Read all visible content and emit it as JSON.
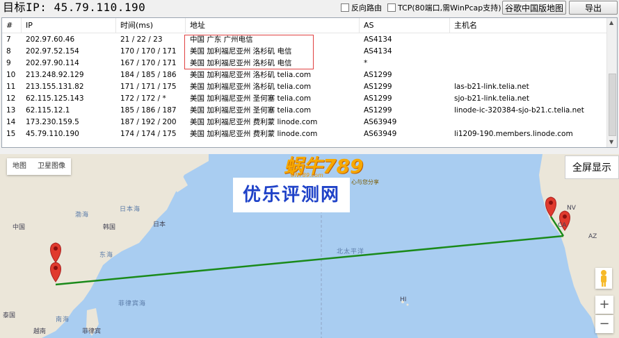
{
  "topbar": {
    "target_ip": "目标IP: 45.79.110.190",
    "reverse_label": "反向路由",
    "tcp_label": "TCP(80端口,需WinPcap支持)",
    "google_map_button": "谷歌中国版地图",
    "export_button": "导出"
  },
  "table": {
    "headers": [
      "#",
      "IP",
      "时间(ms)",
      "地址",
      "AS",
      "主机名"
    ],
    "rows": [
      {
        "n": "7",
        "ip": "202.97.60.46",
        "time": "21 / 22 / 23",
        "addr": "中国 广东 广州电信",
        "as": "AS4134",
        "host": ""
      },
      {
        "n": "8",
        "ip": "202.97.52.154",
        "time": "170 / 170 / 171",
        "addr": "美国 加利福尼亚州 洛杉矶 电信",
        "as": "AS4134",
        "host": ""
      },
      {
        "n": "9",
        "ip": "202.97.90.114",
        "time": "167 / 170 / 171",
        "addr": "美国 加利福尼亚州 洛杉矶 电信",
        "as": "*",
        "host": ""
      },
      {
        "n": "10",
        "ip": "213.248.92.129",
        "time": "184 / 185 / 186",
        "addr": "美国 加利福尼亚州 洛杉矶 telia.com",
        "as": "AS1299",
        "host": ""
      },
      {
        "n": "11",
        "ip": "213.155.131.82",
        "time": "171 / 171 / 175",
        "addr": "美国 加利福尼亚州 洛杉矶 telia.com",
        "as": "AS1299",
        "host": "las-b21-link.telia.net"
      },
      {
        "n": "12",
        "ip": "62.115.125.143",
        "time": "172 / 172 / *",
        "addr": "美国 加利福尼亚州 圣何塞 telia.com",
        "as": "AS1299",
        "host": "sjo-b21-link.telia.net"
      },
      {
        "n": "13",
        "ip": "62.115.12.1",
        "time": "185 / 186 / 187",
        "addr": "美国 加利福尼亚州 圣何塞 telia.com",
        "as": "AS1299",
        "host": "linode-ic-320384-sjo-b21.c.telia.net"
      },
      {
        "n": "14",
        "ip": "173.230.159.5",
        "time": "187 / 192 / 200",
        "addr": "美国 加利福尼亚州 费利蒙 linode.com",
        "as": "AS63949",
        "host": ""
      },
      {
        "n": "15",
        "ip": "45.79.110.190",
        "time": "174 / 174 / 175",
        "addr": "美国 加利福尼亚州 费利蒙 linode.com",
        "as": "AS63949",
        "host": "li1209-190.members.linode.com"
      }
    ]
  },
  "map": {
    "type_map": "地图",
    "type_satellite": "卫星图像",
    "fullscreen": "全屏显示",
    "watermark": "优乐评测网",
    "logo_main": "蜗牛789",
    "logo_sub": "UN789.com",
    "logo_slogan": "心与您分享",
    "zoom_in": "+",
    "zoom_out": "−",
    "labels": {
      "china": "中国",
      "korea": "韩国",
      "japan": "日本",
      "sea_of_japan": "日本海",
      "bohai": "渤海",
      "east_sea": "东海",
      "south_sea": "南海",
      "philippine_sea": "菲律宾海",
      "north_pacific": "北太平洋",
      "thailand": "泰国",
      "vietnam": "越南",
      "philippines": "菲律宾",
      "hi": "HI",
      "nv": "NV",
      "ca": "CA",
      "az": "AZ"
    },
    "colors": {
      "route": "#1a8a1a",
      "pin": "#e03a2e",
      "ocean": "#a9cdf1",
      "land": "#ebe6d9"
    }
  }
}
